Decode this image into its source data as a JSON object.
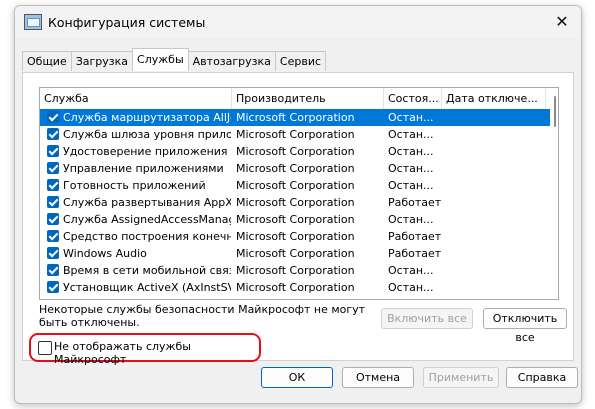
{
  "window": {
    "title": "Конфигурация системы"
  },
  "tabs": [
    {
      "label": "Общие",
      "active": false
    },
    {
      "label": "Загрузка",
      "active": false
    },
    {
      "label": "Службы",
      "active": true
    },
    {
      "label": "Автозагрузка",
      "active": false
    },
    {
      "label": "Сервис",
      "active": false
    }
  ],
  "services": {
    "columns": {
      "service": "Служба",
      "manufacturer": "Производитель",
      "status": "Состоя...",
      "disabled_date": "Дата отключе..."
    },
    "rows": [
      {
        "name": "Служба маршрутизатора AllJoyn",
        "manufacturer": "Microsoft Corporation",
        "status": "Остан...",
        "checked": true,
        "selected": true
      },
      {
        "name": "Служба шлюза уровня прилож...",
        "manufacturer": "Microsoft Corporation",
        "status": "Остан...",
        "checked": true,
        "selected": false
      },
      {
        "name": "Удостоверение приложения",
        "manufacturer": "Microsoft Corporation",
        "status": "Остан...",
        "checked": true,
        "selected": false
      },
      {
        "name": "Управление приложениями",
        "manufacturer": "Microsoft Corporation",
        "status": "Остан...",
        "checked": true,
        "selected": false
      },
      {
        "name": "Готовность приложений",
        "manufacturer": "Microsoft Corporation",
        "status": "Остан...",
        "checked": true,
        "selected": false
      },
      {
        "name": "Служба развертывания AppX (...",
        "manufacturer": "Microsoft Corporation",
        "status": "Работает",
        "checked": true,
        "selected": false
      },
      {
        "name": "Служба AssignedAccessManager",
        "manufacturer": "Microsoft Corporation",
        "status": "Остан...",
        "checked": true,
        "selected": false
      },
      {
        "name": "Средство построения конечн...",
        "manufacturer": "Microsoft Corporation",
        "status": "Работает",
        "checked": true,
        "selected": false
      },
      {
        "name": "Windows Audio",
        "manufacturer": "Microsoft Corporation",
        "status": "Работает",
        "checked": true,
        "selected": false
      },
      {
        "name": "Время в сети мобильной связи",
        "manufacturer": "Microsoft Corporation",
        "status": "Остан...",
        "checked": true,
        "selected": false
      },
      {
        "name": "Установщик ActiveX (AxInstSV)",
        "manufacturer": "Microsoft Corporation",
        "status": "Остан...",
        "checked": true,
        "selected": false
      }
    ]
  },
  "note": "Некоторые службы безопасности Майкрософт не могут быть отключены.",
  "buttons": {
    "enable_all": "Включить все",
    "disable_all": "Отключить все",
    "ok": "ОК",
    "cancel": "Отмена",
    "apply": "Применить",
    "help": "Справка"
  },
  "hide_microsoft": {
    "label": "Не отображать службы Майкрософт",
    "checked": false
  }
}
